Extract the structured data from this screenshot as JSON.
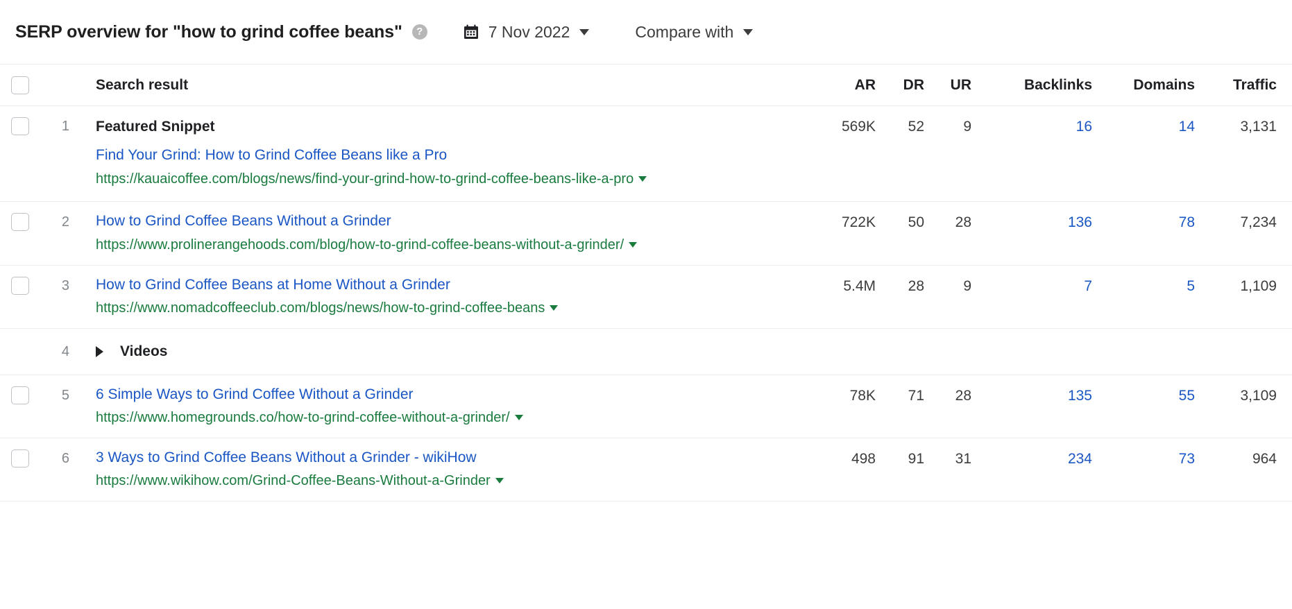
{
  "header": {
    "title": "SERP overview for \"how to grind coffee beans\"",
    "help_icon": "help-circle-icon",
    "calendar_icon": "calendar-icon",
    "date": "7 Nov 2022",
    "date_caret": "chevron-down-icon",
    "compare_label": "Compare with",
    "compare_caret": "chevron-down-icon"
  },
  "table": {
    "columns": {
      "select_all": "select-all-checkbox",
      "search_result": "Search result",
      "ar": "AR",
      "dr": "DR",
      "ur": "UR",
      "backlinks": "Backlinks",
      "domains": "Domains",
      "traffic": "Traffic"
    },
    "rows": [
      {
        "type": "result",
        "rank": "1",
        "kind": "Featured Snippet",
        "title": "Find Your Grind: How to Grind Coffee Beans like a Pro",
        "url": "https://kauaicoffee.com/blogs/news/find-your-grind-how-to-grind-coffee-beans-like-a-pro",
        "ar": "569K",
        "dr": "52",
        "ur": "9",
        "backlinks": "16",
        "domains": "14",
        "traffic": "3,131"
      },
      {
        "type": "result",
        "rank": "2",
        "kind": "",
        "title": "How to Grind Coffee Beans Without a Grinder",
        "url": "https://www.prolinerangehoods.com/blog/how-to-grind-coffee-beans-without-a-grinder/",
        "ar": "722K",
        "dr": "50",
        "ur": "28",
        "backlinks": "136",
        "domains": "78",
        "traffic": "7,234"
      },
      {
        "type": "result",
        "rank": "3",
        "kind": "",
        "title": "How to Grind Coffee Beans at Home Without a Grinder",
        "url": "https://www.nomadcoffeeclub.com/blogs/news/how-to-grind-coffee-beans",
        "ar": "5.4M",
        "dr": "28",
        "ur": "9",
        "backlinks": "7",
        "domains": "5",
        "traffic": "1,109"
      },
      {
        "type": "group",
        "rank": "4",
        "label": "Videos",
        "arrow_icon": "triangle-right-icon"
      },
      {
        "type": "result",
        "rank": "5",
        "kind": "",
        "title": "6 Simple Ways to Grind Coffee Without a Grinder",
        "url": "https://www.homegrounds.co/how-to-grind-coffee-without-a-grinder/",
        "ar": "78K",
        "dr": "71",
        "ur": "28",
        "backlinks": "135",
        "domains": "55",
        "traffic": "3,109"
      },
      {
        "type": "result",
        "rank": "6",
        "kind": "",
        "title": "3 Ways to Grind Coffee Beans Without a Grinder - wikiHow",
        "url": "https://www.wikihow.com/Grind-Coffee-Beans-Without-a-Grinder",
        "ar": "498",
        "dr": "91",
        "ur": "31",
        "backlinks": "234",
        "domains": "73",
        "traffic": "964"
      }
    ]
  },
  "colors": {
    "link_blue": "#1a56c4",
    "url_green": "#1a7b3f",
    "text_dark": "#202124",
    "muted_gray": "#80868b",
    "border": "#eceef0"
  }
}
